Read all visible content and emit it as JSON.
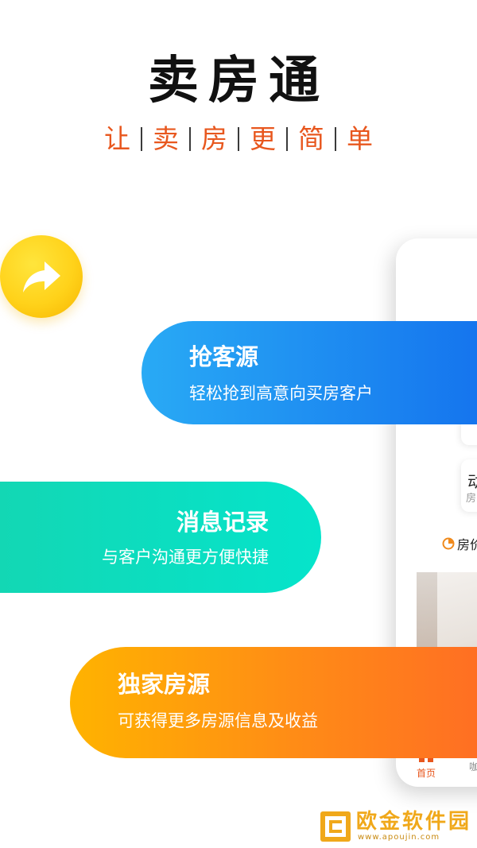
{
  "header": {
    "title": "卖房通",
    "slogan_chars": [
      "让",
      "卖",
      "房",
      "更",
      "简",
      "单"
    ]
  },
  "share": {
    "icon": "share-arrow-icon"
  },
  "features": [
    {
      "title": "抢客源",
      "desc": "轻松抢到高意向买房客户"
    },
    {
      "title": "消息记录",
      "desc": "与客户沟通更方便快捷"
    },
    {
      "title": "独家房源",
      "desc": "可获得更多房源信息及收益"
    }
  ],
  "phone": {
    "dyn_title": "动",
    "dyn_sub": "房",
    "price_label": "房价",
    "tab_home": "首页",
    "tab_next": "咖"
  },
  "watermark": {
    "name": "欧金软件园",
    "url": "www.apoujin.com"
  },
  "colors": {
    "slogan": "#e8571e",
    "pill_blue": "#1575ee",
    "pill_green": "#05e4cb",
    "pill_orange": "#ff8c16",
    "share_yellow": "#ffd21a"
  }
}
